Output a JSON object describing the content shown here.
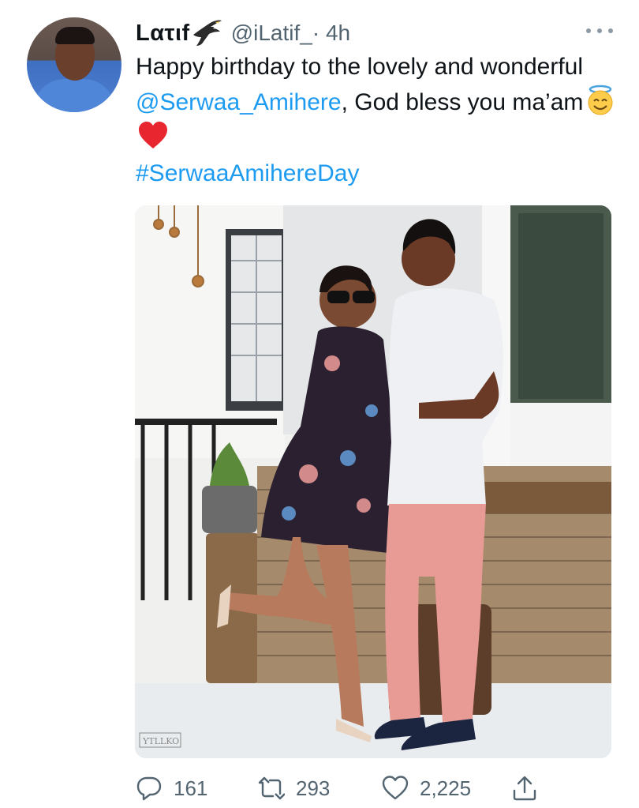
{
  "tweet": {
    "author": {
      "display_name": "Lατιf",
      "name_emoji": "eagle-icon",
      "handle": "@iLatif_",
      "time": "· 4h",
      "avatar": "avatar"
    },
    "text": {
      "part1": "Happy birthday to the lovely and wonderful ",
      "mention": "@Serwaa_Amihere",
      "part2": ", God bless you ma’am",
      "emoji1": "smiling-face-with-halo-icon",
      "emoji2": "red-heart-icon",
      "hashtag": "#SerwaaAmihereDay"
    },
    "media": {
      "watermark": "YTLLKO"
    },
    "metrics": {
      "replies": "161",
      "retweets": "293",
      "likes": "2,225"
    }
  },
  "icons": {
    "more": "more-horizontal-icon",
    "reply": "reply-icon",
    "retweet": "retweet-icon",
    "like": "heart-icon",
    "share": "share-icon"
  },
  "colors": {
    "accent": "#1d9bf0",
    "secondary_text": "#536471",
    "text": "#0f1419"
  }
}
